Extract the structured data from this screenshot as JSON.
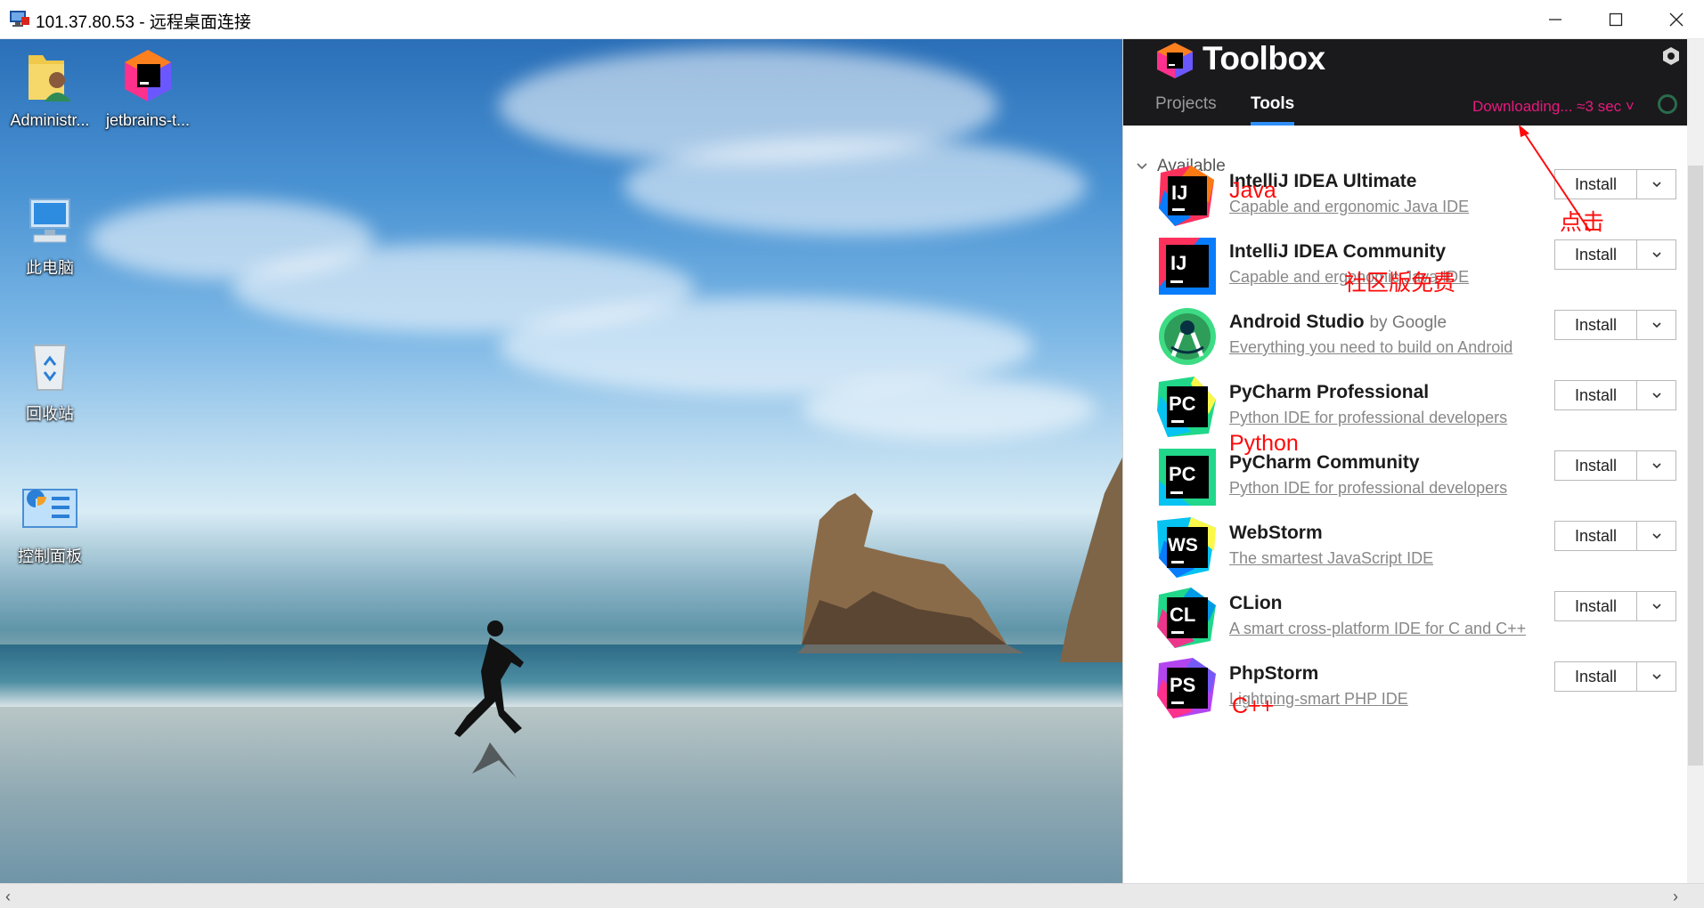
{
  "window": {
    "title": "101.37.80.53 - 远程桌面连接",
    "minimize_glyph": "─",
    "maximize_glyph": "☐",
    "close_glyph": "✕"
  },
  "desktop": {
    "icons": [
      {
        "label": "Administr...",
        "icon": "user-folder-icon"
      },
      {
        "label": "jetbrains-t...",
        "icon": "jetbrains-toolbox-icon"
      },
      {
        "label": "此电脑",
        "icon": "computer-icon"
      },
      {
        "label": "回收站",
        "icon": "recycle-bin-icon"
      },
      {
        "label": "控制面板",
        "icon": "control-panel-icon"
      }
    ]
  },
  "toolbox": {
    "brand": "Toolbox",
    "tabs": [
      {
        "label": "Projects",
        "active": false
      },
      {
        "label": "Tools",
        "active": true
      }
    ],
    "download_status": "Downloading... ≈3 sec ˅",
    "section_label": "Available",
    "install_label": "Install",
    "tools": [
      {
        "name": "IntelliJ IDEA Ultimate",
        "vendor": "",
        "desc": "Capable and ergonomic Java IDE",
        "abbr": "IJ",
        "icon": "intellij-ultimate-icon"
      },
      {
        "name": "IntelliJ IDEA Community",
        "vendor": "",
        "desc": "Capable and ergonomic Java IDE",
        "abbr": "IJ",
        "icon": "intellij-community-icon"
      },
      {
        "name": "Android Studio",
        "vendor": "by Google",
        "desc": "Everything you need to build on Android",
        "abbr": "",
        "icon": "android-studio-icon"
      },
      {
        "name": "PyCharm Professional",
        "vendor": "",
        "desc": "Python IDE for professional developers",
        "abbr": "PC",
        "icon": "pycharm-professional-icon"
      },
      {
        "name": "PyCharm Community",
        "vendor": "",
        "desc": "Python IDE for professional developers",
        "abbr": "PC",
        "icon": "pycharm-community-icon"
      },
      {
        "name": "WebStorm",
        "vendor": "",
        "desc": "The smartest JavaScript IDE",
        "abbr": "WS",
        "icon": "webstorm-icon"
      },
      {
        "name": "CLion",
        "vendor": "",
        "desc": "A smart cross-platform IDE for C and C++",
        "abbr": "CL",
        "icon": "clion-icon"
      },
      {
        "name": "PhpStorm",
        "vendor": "",
        "desc": "Lightning-smart PHP IDE",
        "abbr": "PS",
        "icon": "phpstorm-icon"
      }
    ]
  },
  "annotations": {
    "java": "Java",
    "click": "点击",
    "community_free": "社区版免费",
    "python": "Python",
    "cpp": "C++"
  },
  "colors": {
    "accent_pink": "#e8197e",
    "tab_underline": "#2f8ff7",
    "annotation_red": "#ff0a0a",
    "header_bg": "#1a1a1c"
  }
}
